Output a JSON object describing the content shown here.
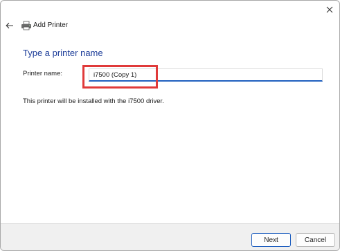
{
  "window": {
    "title": "Add Printer",
    "close_icon": "close-icon",
    "back_icon": "back-arrow-icon",
    "title_icon": "printer-icon"
  },
  "main": {
    "heading": "Type a printer name",
    "printer_name_label": "Printer name:",
    "printer_name_value": "i7500 (Copy 1)",
    "driver_note": "This printer will be installed with the i7500 driver."
  },
  "footer": {
    "next_label": "Next",
    "cancel_label": "Cancel"
  },
  "colors": {
    "heading": "#1f3f9a",
    "accent": "#1f5fbf",
    "highlight": "#e03a3a"
  }
}
